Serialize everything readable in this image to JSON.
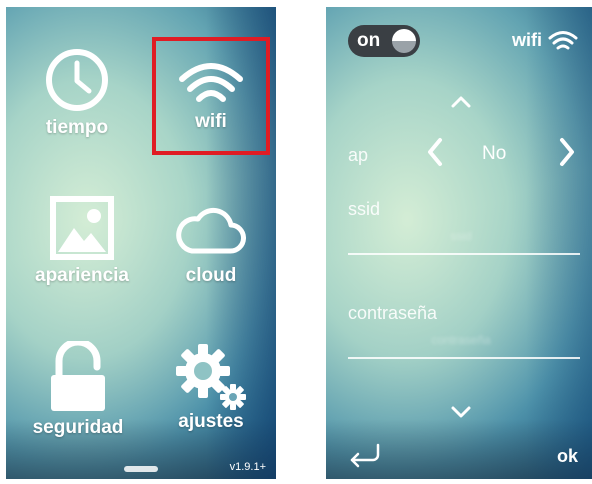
{
  "menu": {
    "items": [
      {
        "id": "tiempo",
        "label": "tiempo",
        "icon": "clock-icon"
      },
      {
        "id": "wifi",
        "label": "wifi",
        "icon": "wifi-icon",
        "selected": true
      },
      {
        "id": "apariencia",
        "label": "apariencia",
        "icon": "image-icon"
      },
      {
        "id": "cloud",
        "label": "cloud",
        "icon": "cloud-icon"
      },
      {
        "id": "seguridad",
        "label": "seguridad",
        "icon": "unlocked-padlock-icon"
      },
      {
        "id": "ajustes",
        "label": "ajustes",
        "icon": "gears-icon"
      }
    ],
    "version": "v1.9.1+"
  },
  "wifi_settings": {
    "toggle_label": "on",
    "title": "wifi",
    "ap": {
      "label": "ap",
      "value": "No"
    },
    "ssid": {
      "label": "ssid",
      "value": "ssid"
    },
    "password": {
      "label": "contraseña",
      "value": "contraseña"
    },
    "ok_label": "ok"
  },
  "colors": {
    "highlight": "#e01c24",
    "text": "#ffffff",
    "toggle_bg": "#3a3f44"
  }
}
